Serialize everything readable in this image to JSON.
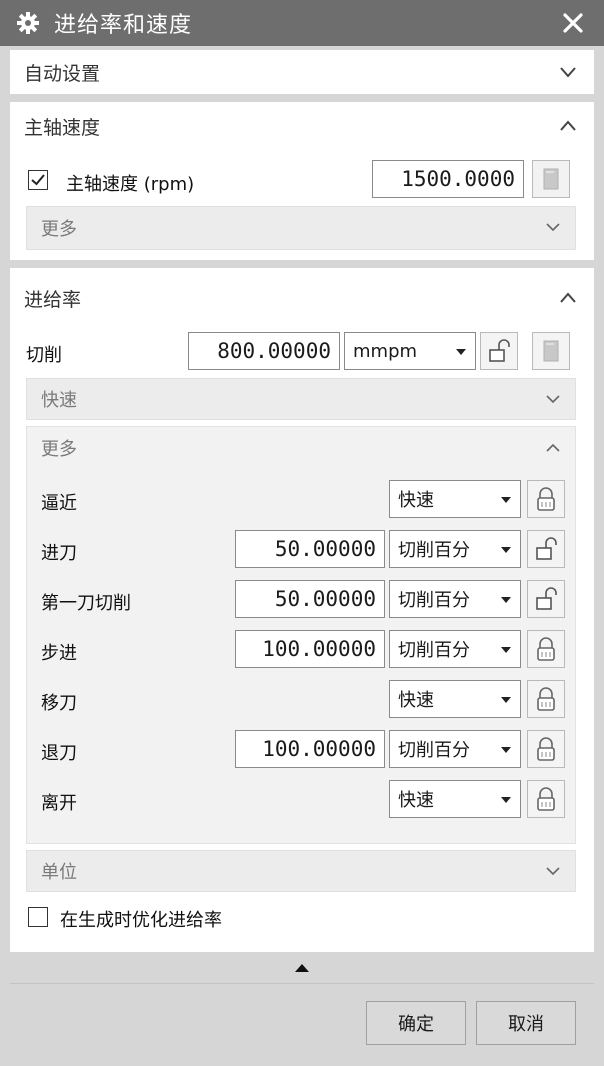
{
  "window": {
    "title": "进给率和速度"
  },
  "auto_settings": {
    "label": "自动设置"
  },
  "spindle": {
    "section_label": "主轴速度",
    "checkbox_label": "主轴速度 (rpm)",
    "checked": true,
    "value": "1500.0000",
    "more_label": "更多"
  },
  "feed": {
    "section_label": "进给率",
    "cut_label": "切削",
    "cut_value": "800.00000",
    "cut_unit": "mmpm",
    "rapid_label": "快速",
    "more_label": "更多",
    "rows": [
      {
        "label": "逼近",
        "value": "",
        "mode": "快速",
        "locked": true
      },
      {
        "label": "进刀",
        "value": "50.00000",
        "mode": "切削百分",
        "locked": false
      },
      {
        "label": "第一刀切削",
        "value": "50.00000",
        "mode": "切削百分",
        "locked": false
      },
      {
        "label": "步进",
        "value": "100.00000",
        "mode": "切削百分",
        "locked": true
      },
      {
        "label": "移刀",
        "value": "",
        "mode": "快速",
        "locked": true
      },
      {
        "label": "退刀",
        "value": "100.00000",
        "mode": "切削百分",
        "locked": true
      },
      {
        "label": "离开",
        "value": "",
        "mode": "快速",
        "locked": true
      }
    ],
    "units_label": "单位",
    "optimize_label": "在生成时优化进给率",
    "optimize_checked": false
  },
  "buttons": {
    "ok": "确定",
    "cancel": "取消"
  }
}
